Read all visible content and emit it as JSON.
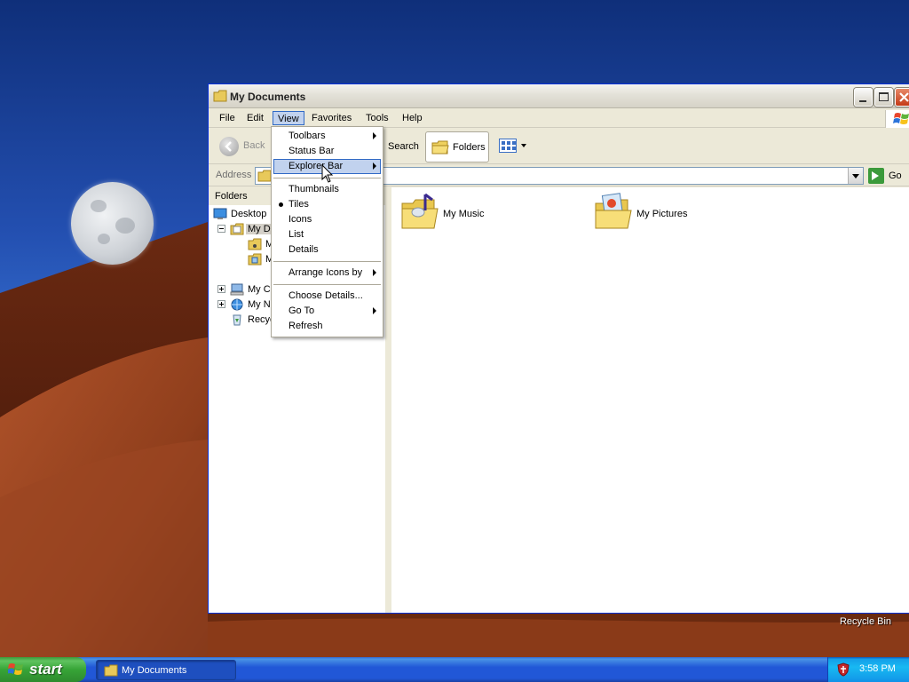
{
  "window": {
    "title": "My Documents",
    "menu": [
      "File",
      "Edit",
      "View",
      "Favorites",
      "Tools",
      "Help"
    ],
    "active_menu": "View",
    "toolbar": {
      "back_label": "Back",
      "search_label": "Search",
      "folders_label": "Folders"
    },
    "address": {
      "label": "Address",
      "value": "",
      "go_label": "Go"
    },
    "folders_pane": {
      "header": "Folders",
      "tree": [
        {
          "label": "Desktop",
          "icon": "desktop-icon"
        },
        {
          "label": "My Do",
          "icon": "my-documents-folder-icon",
          "selected": true,
          "expander": "minus"
        },
        {
          "label": "M",
          "icon": "my-music-folder-icon"
        },
        {
          "label": "M",
          "icon": "my-pictures-folder-icon"
        },
        {
          "label": "My Co",
          "icon": "my-computer-icon",
          "expander": "plus"
        },
        {
          "label": "My Ne",
          "icon": "my-network-places-icon",
          "expander": "plus"
        },
        {
          "label": "Recyc",
          "icon": "recycle-bin-icon"
        }
      ]
    },
    "content": {
      "items": [
        {
          "label": "My Music",
          "icon": "music-folder-icon"
        },
        {
          "label": "My Pictures",
          "icon": "pictures-folder-icon"
        }
      ]
    }
  },
  "view_menu": {
    "items": [
      {
        "label": "Toolbars",
        "submenu": true
      },
      {
        "label": "Status Bar"
      },
      {
        "label": "Explorer Bar",
        "submenu": true,
        "highlighted": true
      },
      {
        "separator": true
      },
      {
        "label": "Thumbnails"
      },
      {
        "label": "Tiles",
        "checked": true
      },
      {
        "label": "Icons"
      },
      {
        "label": "List"
      },
      {
        "label": "Details"
      },
      {
        "separator": true
      },
      {
        "label": "Arrange Icons by",
        "submenu": true
      },
      {
        "separator": true
      },
      {
        "label": "Choose Details..."
      },
      {
        "label": "Go To",
        "submenu": true
      },
      {
        "label": "Refresh"
      }
    ]
  },
  "desktop": {
    "recycle_bin_label": "Recycle Bin"
  },
  "taskbar": {
    "start_label": "start",
    "task_label": "My Documents",
    "clock": "3:58 PM"
  },
  "colors": {
    "menu_highlight": "#c1d2ee",
    "menu_highlight_border": "#316ac5",
    "taskbar_blue": "#2157d7",
    "start_green": "#37a437"
  }
}
